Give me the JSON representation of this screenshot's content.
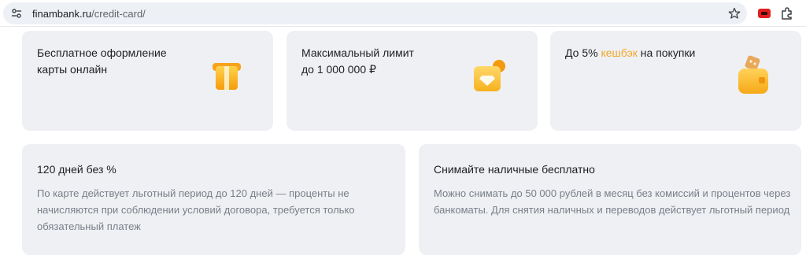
{
  "browser": {
    "url_host": "finambank.ru",
    "url_path": "/credit-card/",
    "icons": [
      "tune-icon",
      "star-icon",
      "youtube-extension-icon",
      "extensions-puzzle-icon"
    ]
  },
  "features": [
    {
      "title_lines": [
        "Бесплатное оформление",
        "карты онлайн"
      ],
      "icon": "card-icon"
    },
    {
      "title_lines": [
        "Максимальный лимит",
        "до 1 000 000 ₽"
      ],
      "icon": "wallet-diamond-icon"
    },
    {
      "title_before": "До 5% ",
      "title_accent": "кешбэк",
      "title_after": " на покупки",
      "icon": "bag-coins-icon"
    }
  ],
  "benefits": [
    {
      "title": "120 дней без %",
      "desc_lines": [
        "По карте действует льготный период до 120 дней — проценты не",
        "начисляются при соблюдении условий договора, требуется только",
        "обязательный платеж"
      ]
    },
    {
      "title": "Снимайте наличные бесплатно",
      "desc_lines": [
        "Можно снимать до 50 000 рублей в месяц без комиссий и процентов через",
        "банкоматы. Для снятия наличных и переводов действует льготный период"
      ]
    }
  ],
  "colors": {
    "card_bg": "#eef0f4",
    "accent": "#f5a623",
    "muted_text": "#7a7f88"
  }
}
